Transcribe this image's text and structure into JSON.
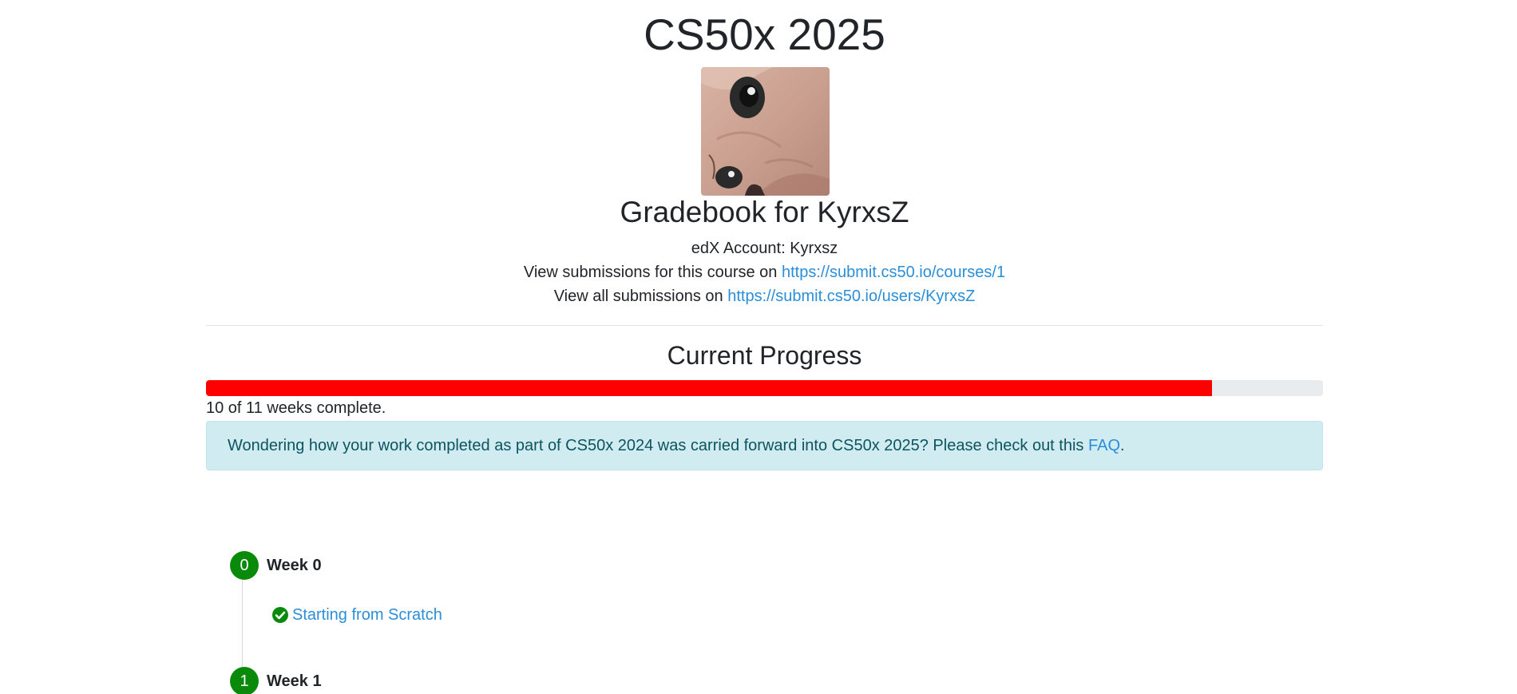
{
  "course": {
    "title": "CS50x 2025"
  },
  "profile": {
    "gradebook_title": "Gradebook for KyrxsZ",
    "edx_account": "edX Account: Kyrxsz",
    "course_submissions_prefix": "View submissions for this course on ",
    "course_submissions_link": "https://submit.cs50.io/courses/1",
    "all_submissions_prefix": "View all submissions on ",
    "all_submissions_link": "https://submit.cs50.io/users/KyrxsZ"
  },
  "progress": {
    "title": "Current Progress",
    "weeks_complete": 10,
    "weeks_total": 11,
    "text": "10 of 11 weeks complete.",
    "bar_color": "#ff0000",
    "track_color": "#e9ecef"
  },
  "notice": {
    "text": "Wondering how your work completed as part of CS50x 2024 was carried forward into CS50x 2025? Please check out this ",
    "link_text": "FAQ",
    "suffix": "."
  },
  "weeks": [
    {
      "number": "0",
      "label": "Week 0",
      "items": [
        {
          "label": "Starting from Scratch",
          "status": "complete",
          "icon": "check-circle-icon"
        }
      ]
    },
    {
      "number": "1",
      "label": "Week 1",
      "items": []
    }
  ],
  "colors": {
    "link": "#2a8ed8",
    "complete": "#0a8a0a",
    "alert_bg": "#d1ecf1",
    "alert_text": "#0c5460"
  }
}
